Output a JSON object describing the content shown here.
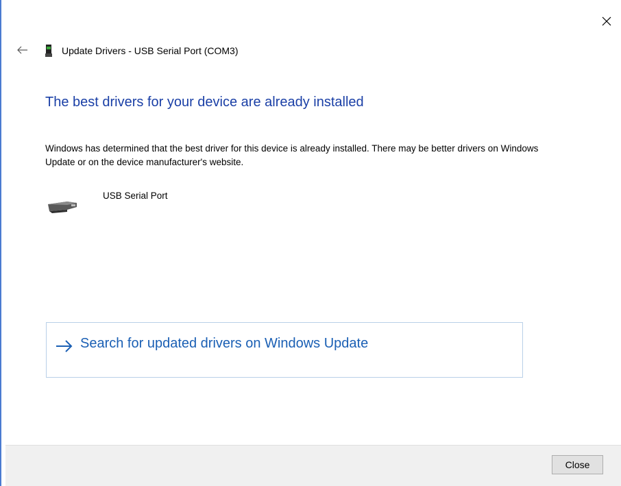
{
  "window": {
    "title": "Update Drivers - USB Serial Port (COM3)"
  },
  "icons": {
    "close": "close-icon",
    "back": "back-arrow-icon",
    "device_small": "usb-device-icon",
    "device_large": "usb-serial-port-icon",
    "link_arrow": "right-arrow-icon"
  },
  "main": {
    "heading": "The best drivers for your device are already installed",
    "description": "Windows has determined that the best driver for this device is already installed. There may be better drivers on Windows Update or on the device manufacturer's website.",
    "device_name": "USB Serial Port",
    "search_link": "Search for updated drivers on Windows Update"
  },
  "footer": {
    "close_label": "Close"
  },
  "colors": {
    "heading": "#1a3fa6",
    "link": "#1a5fb4",
    "footer_bg": "#f0f0f0"
  }
}
